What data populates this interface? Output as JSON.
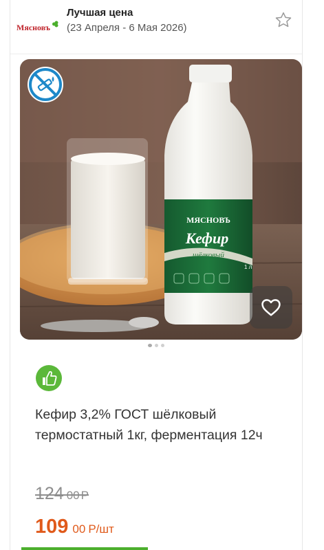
{
  "promo": {
    "logo_text": "Мясновъ",
    "title": "Лучшая цена",
    "dates": "(23 Апреля - 6 Мая 2026)"
  },
  "product": {
    "name": "Кефир 3,2% ГОСТ шёлковый термостатный 1кг, ферментация 12ч",
    "old_price": {
      "rub": "124",
      "kop": "00",
      "currency": "Р"
    },
    "new_price": {
      "rub": "109",
      "kop": "00",
      "currency": "Р/шт"
    },
    "bottle_label": {
      "brand": "МЯСНОВЪ",
      "product": "Кефир",
      "sub": "шёлковый",
      "volume": "1 л"
    }
  },
  "image_carousel": {
    "count": 3,
    "active_index": 0
  },
  "icons": {
    "favorite": "star-outline-icon",
    "wishlist": "heart-icon",
    "badge": "no-hormones-icon",
    "recommend": "thumbs-up-icon"
  },
  "colors": {
    "accent_green": "#4caf2d",
    "price_orange": "#e05a1b",
    "logo_red": "#c0262d"
  }
}
